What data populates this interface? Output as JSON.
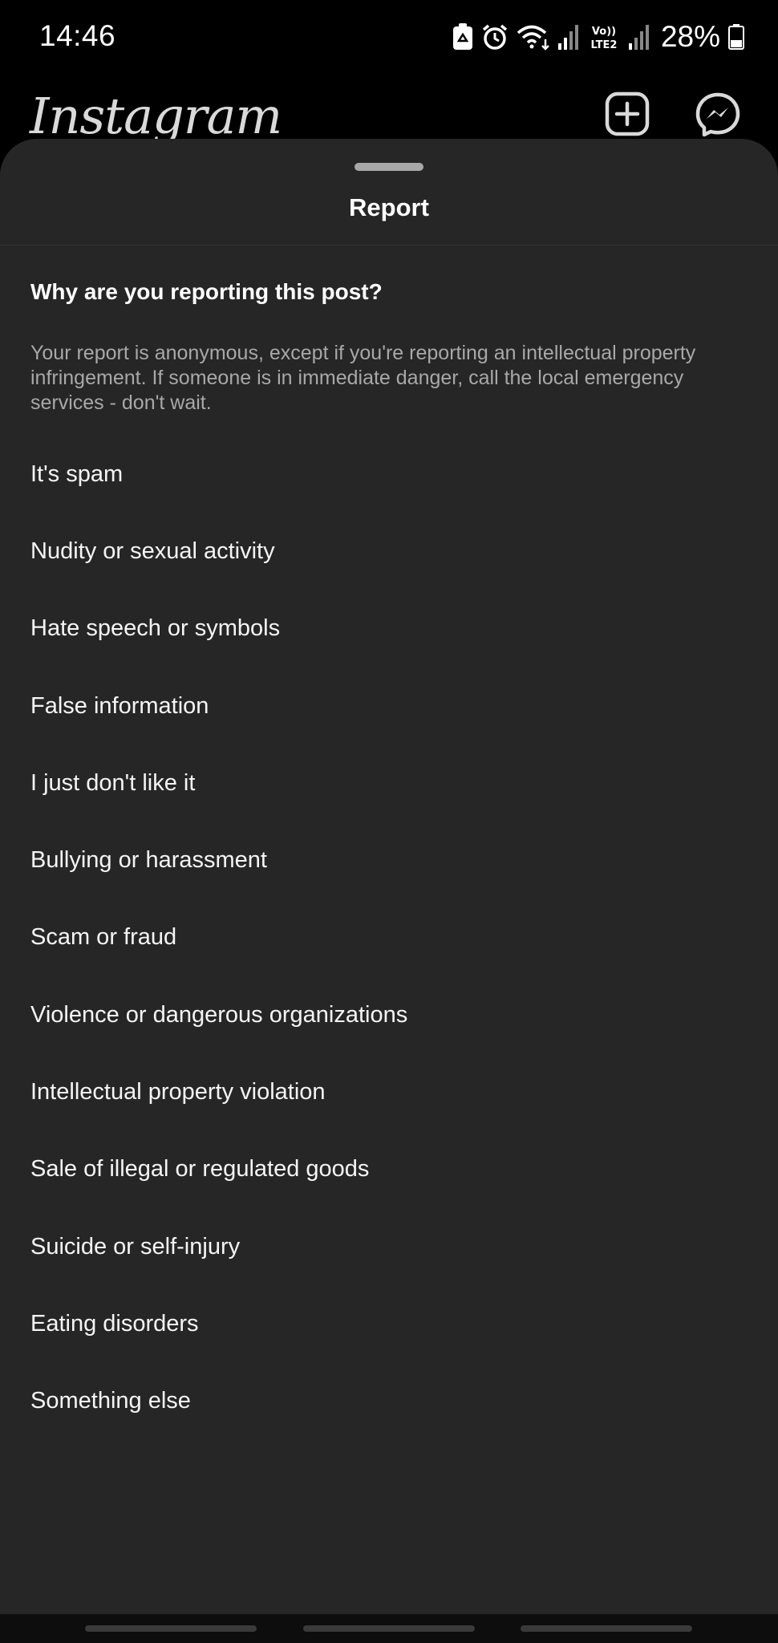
{
  "status_bar": {
    "time": "14:46",
    "battery": "28%",
    "icons": [
      "recycle-notification-icon",
      "alarm-icon",
      "wifi-icon",
      "signal-icon",
      "volte-lte2-icon",
      "signal-icon",
      "battery-icon"
    ]
  },
  "app": {
    "logo": "Instagram",
    "header_icons": [
      "new-post-icon",
      "messenger-icon"
    ]
  },
  "sheet": {
    "title": "Report",
    "question": "Why are you reporting this post?",
    "disclaimer": "Your report is anonymous, except if you're reporting an intellectual property infringement. If someone is in immediate danger, call the local emergency services - don't wait.",
    "options": [
      "It's spam",
      "Nudity or sexual activity",
      "Hate speech or symbols",
      "False information",
      "I just don't like it",
      "Bullying or harassment",
      "Scam or fraud",
      "Violence or dangerous organizations",
      "Intellectual property violation",
      "Sale of illegal or regulated goods",
      "Suicide or self-injury",
      "Eating disorders",
      "Something else"
    ]
  },
  "colors": {
    "sheet_background": "#262626",
    "secondary_text": "#a8a8a8",
    "primary_text": "#ffffff"
  }
}
